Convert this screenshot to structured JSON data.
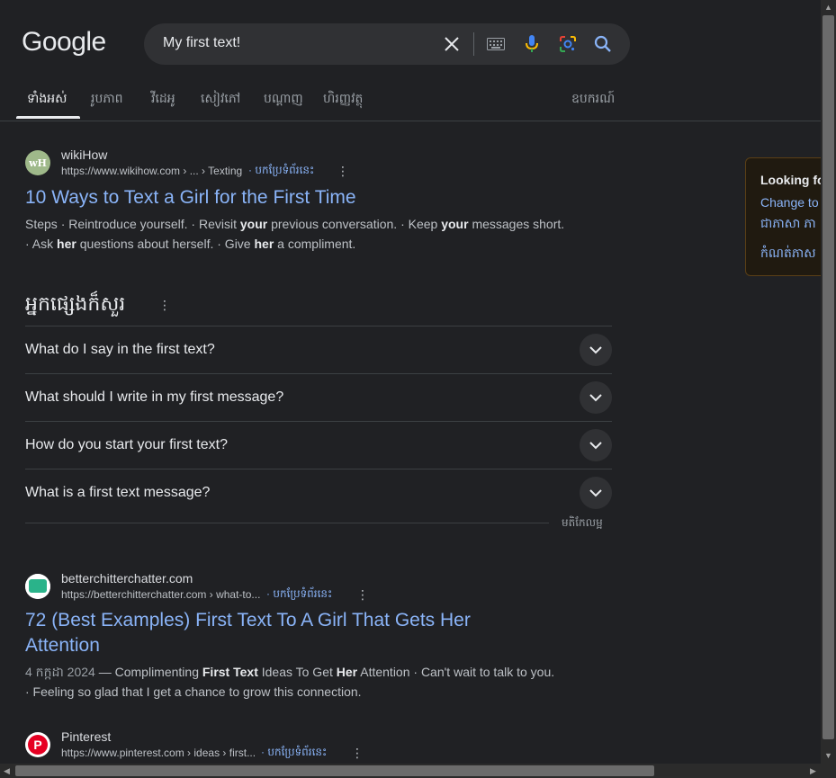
{
  "header": {
    "logo": "Google",
    "query": "My first text!"
  },
  "tabs": {
    "items": [
      "ទាំងអស់",
      "រូបភាព",
      "វីដេអូ",
      "សៀវភៅ",
      "បណ្ដាញ",
      "ហិរញ្ញវត្ថុ"
    ],
    "tools": "ឧបករណ៍"
  },
  "results": [
    {
      "favicon": "wH",
      "site": "wikiHow",
      "url": "https://www.wikihow.com › ... › Texting",
      "translate": "· បកប្រែទំព័រនេះ",
      "title": "10 Ways to Text a Girl for the First Time",
      "snippet_line1": [
        "Steps · Reintroduce yourself. · Revisit ",
        "your",
        " previous conversation. · Keep ",
        "your",
        " messages short."
      ],
      "snippet_line2": [
        "· Ask ",
        "her",
        " questions about herself. · Give ",
        "her",
        " a compliment."
      ]
    },
    {
      "favicon": "",
      "site": "betterchitterchatter.com",
      "url": "https://betterchitterchatter.com › what-to...",
      "translate": "· បកប្រែទំព័រនេះ",
      "title_line1": "72 (Best Examples) First Text To A Girl That Gets Her",
      "title_line2": "Attention",
      "date": "4 កក្កដា 2024",
      "snippet_line1": [
        " — Complimenting ",
        "First Text",
        " Ideas To Get ",
        "Her",
        " Attention · Can't wait to talk to you."
      ],
      "snippet_line2": "· Feeling so glad that I get a chance to grow this connection."
    },
    {
      "favicon": "P",
      "site": "Pinterest",
      "url": "https://www.pinterest.com › ideas › first...",
      "translate": "· បកប្រែទំព័រនេះ"
    }
  ],
  "paa": {
    "heading": "អ្នកផ្សេងក៏សួរ",
    "questions": [
      "What do I say in the first text?",
      "What should I write in my first message?",
      "How do you start your first text?",
      "What is a first text message?"
    ],
    "feedback": "មតិកែលម្អ"
  },
  "side_panel": {
    "title": "Looking fo",
    "link1": "Change to E",
    "link2": "ជាភាសា ភា",
    "link3": "កំណត់ភាស"
  },
  "colors": {
    "background": "#202124",
    "link": "#8ab4f8",
    "text": "#bdc1c6"
  }
}
